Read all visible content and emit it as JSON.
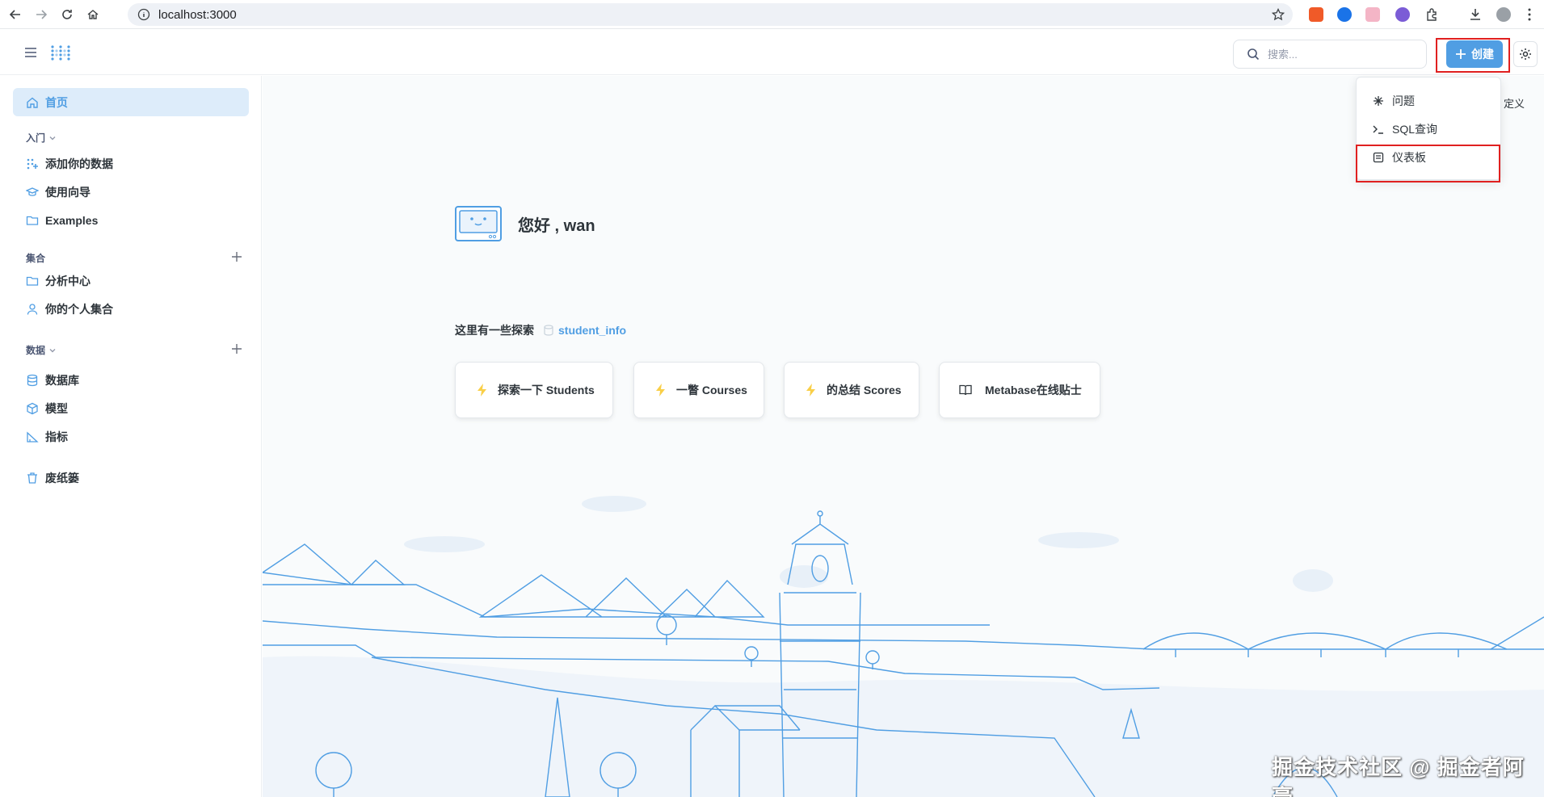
{
  "browser": {
    "url": "localhost:3000"
  },
  "header": {
    "search_placeholder": "搜索...",
    "create_label": "创建"
  },
  "sidebar": {
    "home": "首页",
    "getting_started": {
      "title": "入门",
      "items": [
        "添加你的数据",
        "使用向导",
        "Examples"
      ]
    },
    "collections": {
      "title": "集合",
      "items": [
        "分析中心",
        "你的个人集合"
      ]
    },
    "data": {
      "title": "数据",
      "items": [
        "数据库",
        "模型",
        "指标"
      ]
    },
    "trash": "废纸篓"
  },
  "main": {
    "greeting": "您好 , wan",
    "explore_label": "这里有一些探索",
    "explore_db": "student_info",
    "cards": [
      "探索一下 Students",
      "一瞥 Courses",
      "的总结 Scores",
      "Metabase在线贴士"
    ],
    "customize": "定义"
  },
  "create_menu": {
    "items": [
      "问题",
      "SQL查询",
      "仪表板"
    ]
  },
  "watermark": "掘金技术社区 @ 掘金者阿豪",
  "colors": {
    "brand": "#509ee3",
    "highlight": "#e02020"
  }
}
